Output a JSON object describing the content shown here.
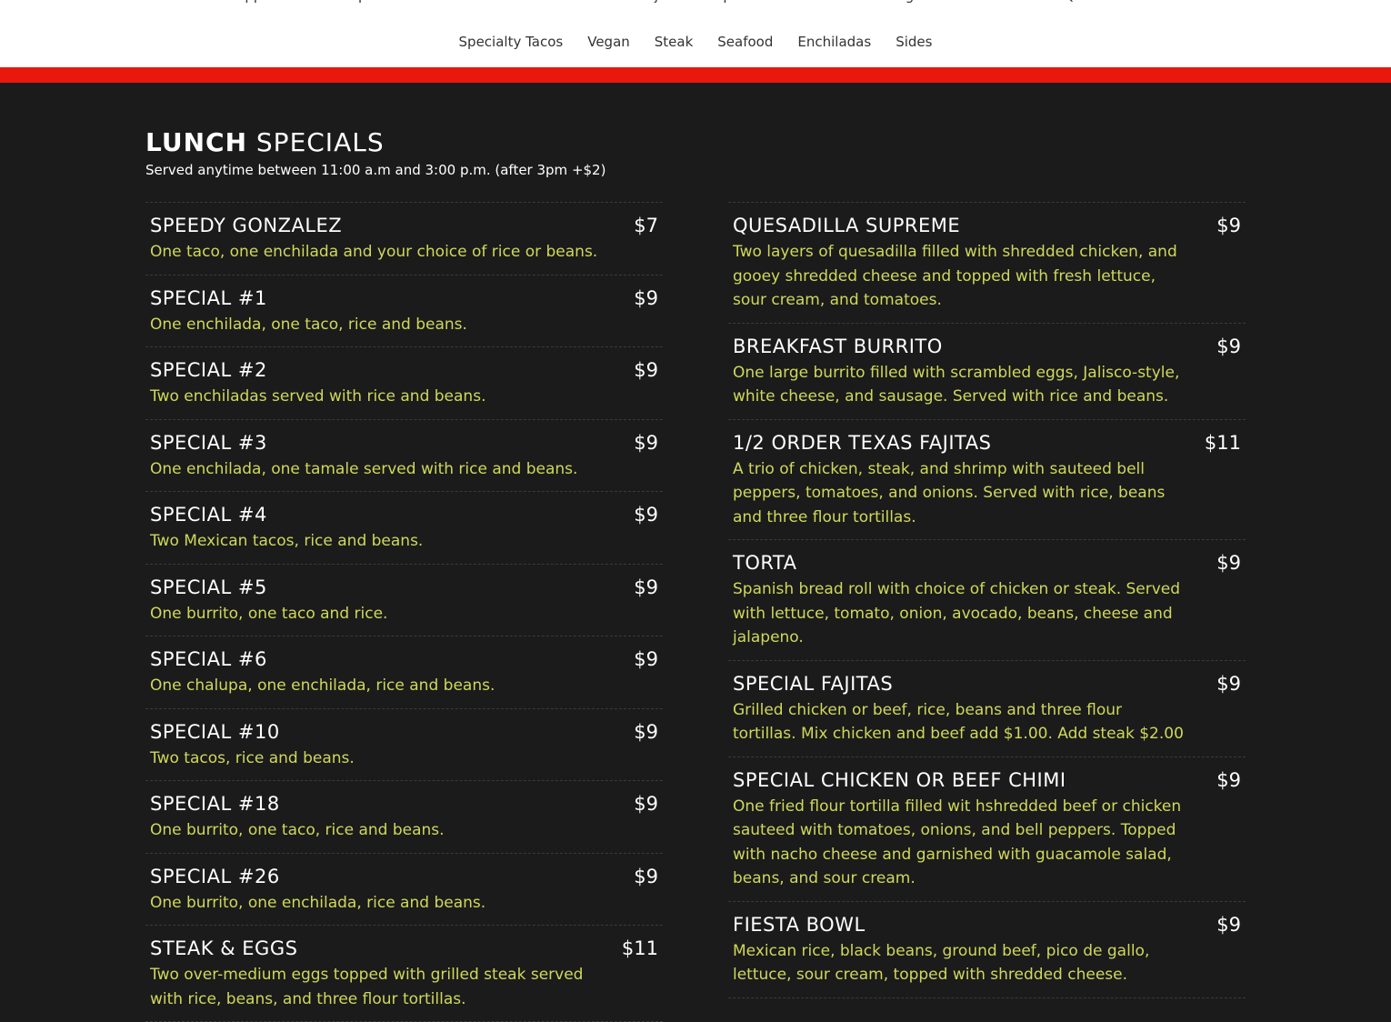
{
  "nav": {
    "row1": [
      "Lunch",
      "Appetizers",
      "Soups & Salads",
      "Pollo Plates",
      "Nachos",
      "Fajitas",
      "Especialidades",
      "Chimichangas",
      "Birria Lovers",
      "Quesadillas",
      "Burritos"
    ],
    "row2": [
      "Specialty Tacos",
      "Vegan",
      "Steak",
      "Seafood",
      "Enchiladas",
      "Sides"
    ]
  },
  "colors": {
    "accent_bar": "#e8180c",
    "background": "#1b1b1b",
    "description": "#cfd85a"
  },
  "section": {
    "title_strong": "LUNCH",
    "title_rest": "SPECIALS",
    "subtitle": "Served anytime between 11:00 a.m and 3:00 p.m. (after 3pm +$2)"
  },
  "left_items": [
    {
      "name": "SPEEDY GONZALEZ",
      "price": "$7",
      "desc": "One taco, one enchilada and your choice of rice or beans."
    },
    {
      "name": "SPECIAL #1",
      "price": "$9",
      "desc": "One enchilada, one taco, rice and beans."
    },
    {
      "name": "SPECIAL #2",
      "price": "$9",
      "desc": "Two enchiladas served with rice and beans."
    },
    {
      "name": "SPECIAL #3",
      "price": "$9",
      "desc": "One enchilada, one tamale served with rice and beans."
    },
    {
      "name": "SPECIAL #4",
      "price": "$9",
      "desc": "Two Mexican tacos, rice and beans."
    },
    {
      "name": "SPECIAL #5",
      "price": "$9",
      "desc": "One burrito, one taco and rice."
    },
    {
      "name": "SPECIAL #6",
      "price": "$9",
      "desc": "One chalupa, one enchilada, rice and beans."
    },
    {
      "name": "SPECIAL #10",
      "price": "$9",
      "desc": "Two tacos, rice and beans."
    },
    {
      "name": "SPECIAL #18",
      "price": "$9",
      "desc": "One burrito, one taco, rice and beans."
    },
    {
      "name": "SPECIAL #26",
      "price": "$9",
      "desc": "One burrito, one enchilada, rice and beans."
    },
    {
      "name": "STEAK & EGGS",
      "price": "$11",
      "desc": "Two over-medium eggs topped with grilled steak served with rice, beans, and three flour tortillas."
    }
  ],
  "right_items": [
    {
      "name": "QUESADILLA SUPREME",
      "price": "$9",
      "desc": "Two layers of quesadilla filled with shredded chicken, and gooey shredded cheese and topped with fresh lettuce, sour cream, and tomatoes."
    },
    {
      "name": "BREAKFAST BURRITO",
      "price": "$9",
      "desc": "One large burrito filled with scrambled eggs, Jalisco-style, white cheese, and sausage. Served with rice and beans."
    },
    {
      "name": "1/2 ORDER TEXAS FAJITAS",
      "price": "$11",
      "desc": "A trio of chicken, steak, and shrimp with sauteed bell peppers, tomatoes, and onions. Served with rice, beans and three flour tortillas."
    },
    {
      "name": "TORTA",
      "price": "$9",
      "desc": "Spanish bread roll with choice of chicken or steak. Served with lettuce, tomato, onion, avocado, beans, cheese and jalapeno."
    },
    {
      "name": "SPECIAL FAJITAS",
      "price": "$9",
      "desc": "Grilled chicken or beef, rice, beans and three flour tortillas. Mix chicken and beef add $1.00. Add steak $2.00"
    },
    {
      "name": "SPECIAL CHICKEN OR BEEF CHIMI",
      "price": "$9",
      "desc": "One fried flour tortilla filled wit hshredded beef or chicken sauteed with tomatoes, onions, and bell peppers. Topped with nacho cheese and garnished with guacamole salad, beans, and sour cream."
    },
    {
      "name": "FIESTA BOWL",
      "price": "$9",
      "desc": "Mexican rice, black beans, ground beef, pico de gallo, lettuce, sour cream, topped with shredded cheese."
    }
  ]
}
